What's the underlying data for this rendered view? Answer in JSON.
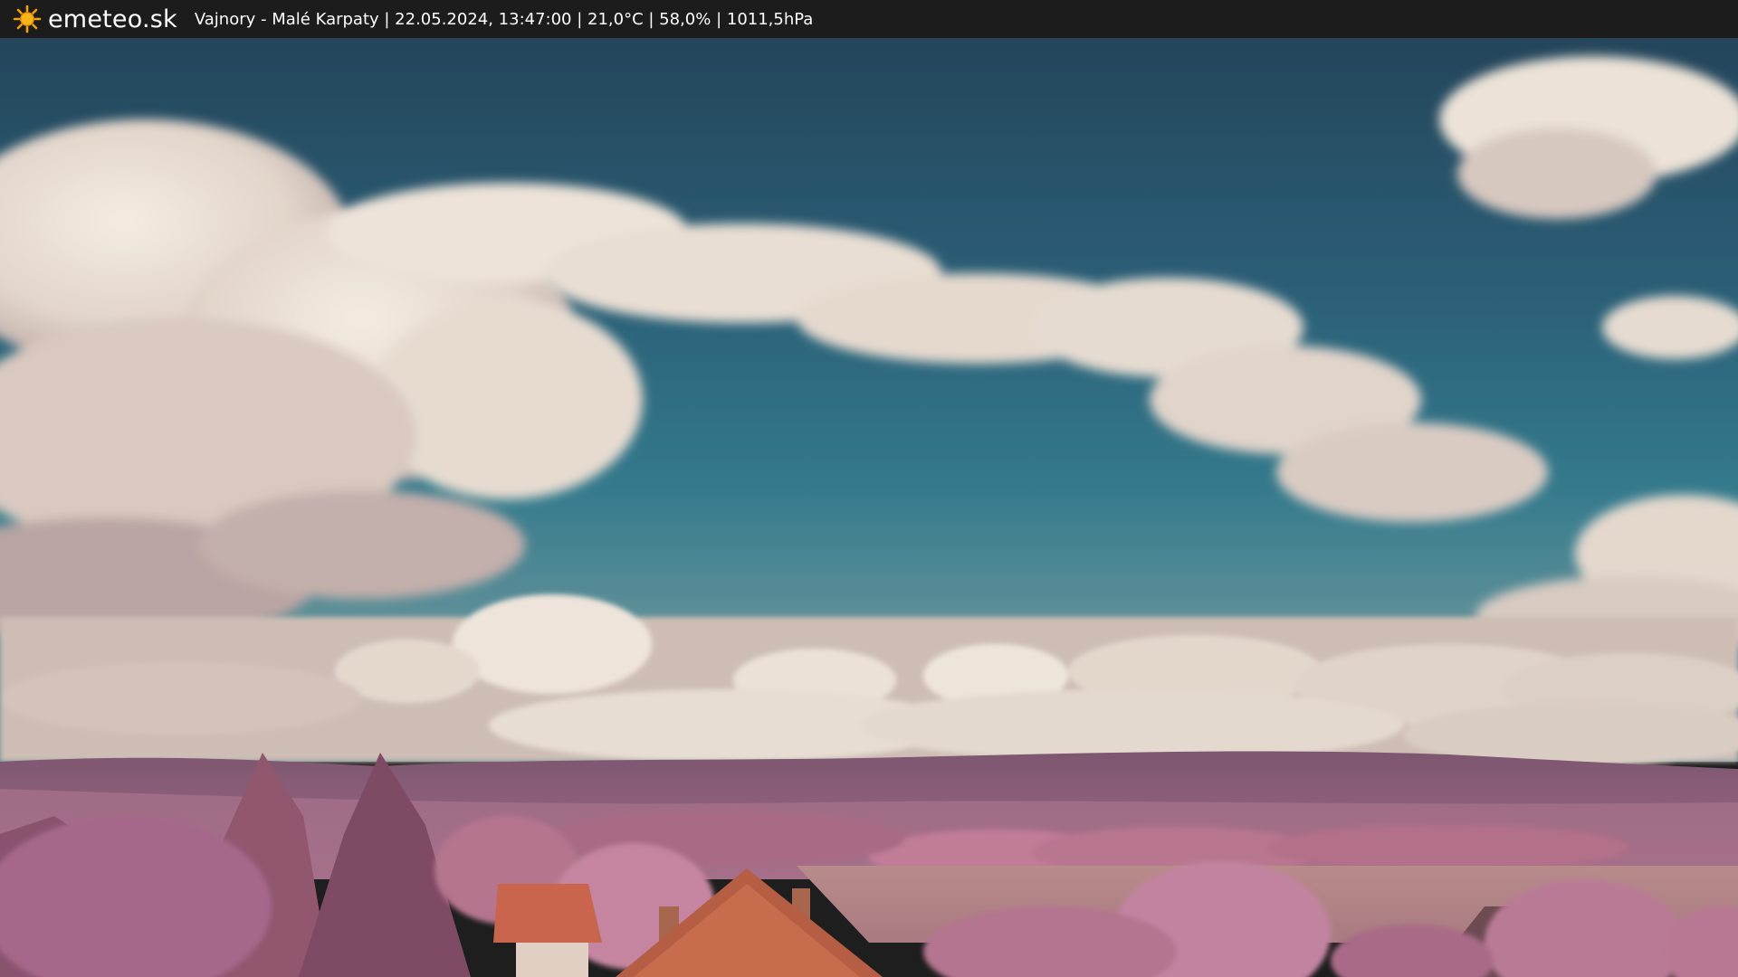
{
  "header": {
    "brand": "emeteo.sk",
    "caption": "Vajnory - Malé Karpaty | 22.05.2024, 13:47:00 | 21,0°C | 58,0% | 1011,5hPa",
    "logo_icon": "sun-icon"
  },
  "image": {
    "kind": "webcam-photo",
    "description_icon": "camera-view",
    "colors": {
      "sky_top": "#24465a",
      "sky_mid": "#2f6e85",
      "sky_horizon": "#4d8a96",
      "cloud": "#eadfd3",
      "cloud_shadow": "#b9a6a4",
      "hills": "#8e5f7a",
      "foliage": "#b9768f",
      "foliage_dark": "#7b4761",
      "field": "#b5898a",
      "roof": "#c9654c"
    }
  }
}
